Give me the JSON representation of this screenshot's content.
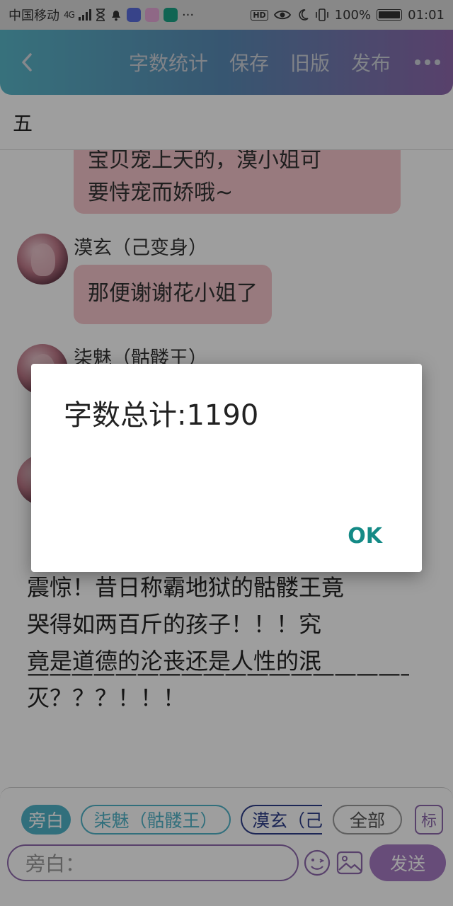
{
  "statusbar": {
    "carrier": "中国移动",
    "network": "4G",
    "more": "···",
    "hd": "HD",
    "battery": "100%",
    "time": "01:01"
  },
  "toolbar": {
    "word_count": "字数统计",
    "save": "保存",
    "old_version": "旧版",
    "publish": "发布"
  },
  "page_title": "五",
  "chat": {
    "messages": [
      {
        "text_line1": "宝贝宠上天的，漠小姐可",
        "text_line2": "要恃宠而娇哦~"
      },
      {
        "name": "漠玄（己变身）",
        "text": "那便谢谢花小姐了"
      },
      {
        "name": "柒魅（骷髅王）"
      }
    ],
    "narration_line1": "震惊！昔日称霸地狱的骷髅王竟",
    "narration_line2": "哭得如两百斤的孩子！！！究",
    "narration_line3": "竟是道德的沦丧还是人性的泯",
    "narration_line4": "灭？？？！！！",
    "divider": "————————————————————"
  },
  "composer": {
    "chips": [
      "旁白",
      "柒魅（骷髅王）",
      "漠玄（己",
      "全部",
      "标"
    ],
    "input_placeholder": "旁白：",
    "send": "发送"
  },
  "dialog": {
    "message": "字数总计:1190",
    "ok": "OK"
  },
  "colors": {
    "accent_teal": "#4fb3c8",
    "accent_purple": "#8f69ad",
    "bubble_pink": "#f6c6cb",
    "ok_green": "#148a86"
  }
}
